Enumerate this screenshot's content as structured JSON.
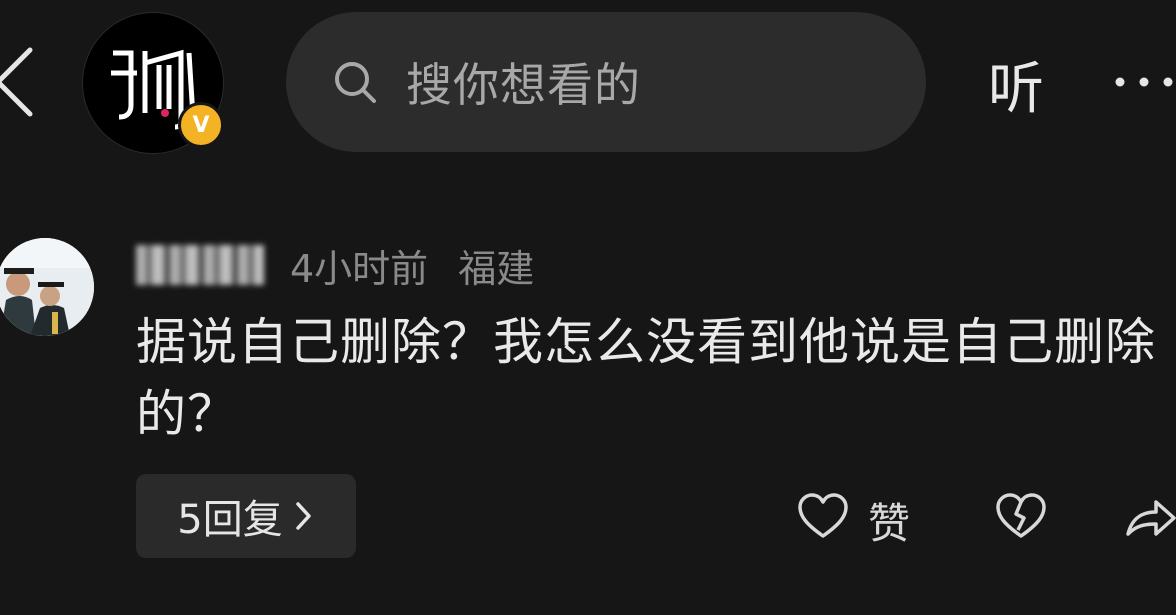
{
  "header": {
    "search_placeholder": "搜你想看的",
    "listen_label": "听",
    "author_logo_text": "狐",
    "verified_badge": "V"
  },
  "comment": {
    "time": "4小时前",
    "location": "福建",
    "text": "据说自己删除？我怎么没看到他说是自己删除的？",
    "replies_label": "5回复",
    "like_label": "赞"
  },
  "colors": {
    "background": "#161616",
    "search_bg": "#2c2c2c",
    "badge": "#f4b324",
    "reply_bg": "#2a2a2a"
  },
  "icons": [
    "back-icon",
    "search-icon",
    "more-icon",
    "chevron-right-icon",
    "heart-icon",
    "broken-heart-icon",
    "share-icon"
  ]
}
